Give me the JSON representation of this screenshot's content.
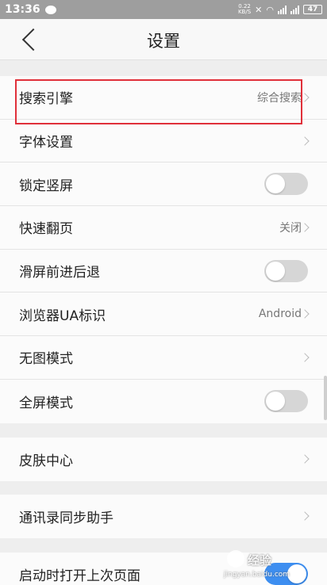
{
  "status_bar": {
    "time": "13:36",
    "net_speed_value": "0.22",
    "net_speed_unit": "KB/S",
    "battery": "47"
  },
  "header": {
    "title": "设置"
  },
  "groups": [
    {
      "rows": [
        {
          "label": "搜索引擎",
          "value": "综合搜索",
          "control": "chevron"
        },
        {
          "label": "字体设置",
          "value": "",
          "control": "chevron"
        },
        {
          "label": "锁定竖屏",
          "control": "toggle",
          "on": false
        },
        {
          "label": "快速翻页",
          "value": "关闭",
          "control": "chevron"
        },
        {
          "label": "滑屏前进后退",
          "control": "toggle",
          "on": false
        },
        {
          "label": "浏览器UA标识",
          "value": "Android",
          "control": "chevron"
        },
        {
          "label": "无图模式",
          "value": "",
          "control": "chevron"
        },
        {
          "label": "全屏模式",
          "control": "toggle",
          "on": false
        }
      ]
    },
    {
      "rows": [
        {
          "label": "皮肤中心",
          "value": "",
          "control": "chevron"
        }
      ]
    },
    {
      "rows": [
        {
          "label": "通讯录同步助手",
          "value": "",
          "control": "chevron"
        }
      ]
    },
    {
      "rows": [
        {
          "label": "启动时打开上次页面",
          "control": "toggle",
          "on": true
        }
      ]
    }
  ],
  "watermark": {
    "text": "经验",
    "url": "jingyan.baidu.com"
  },
  "colors": {
    "highlight": "#e0303a",
    "toggle_on": "#3d8ef0",
    "toggle_off": "#d6d6d6"
  }
}
